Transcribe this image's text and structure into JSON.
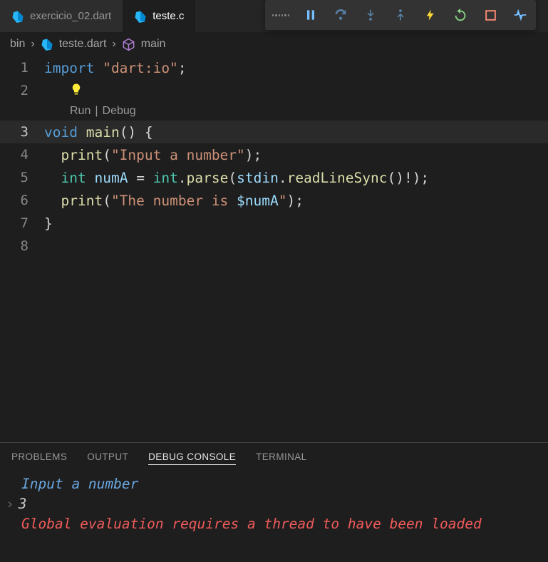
{
  "tabs": {
    "items": [
      {
        "label": "exercicio_02.dart",
        "active": false
      },
      {
        "label": "teste.dart",
        "visible_label": "teste.c",
        "active": true
      }
    ]
  },
  "debug_toolbar": {
    "icons": [
      "grip",
      "pause",
      "step-over",
      "step-into",
      "step-out",
      "hot-reload",
      "restart",
      "stop",
      "dev-tools"
    ]
  },
  "breadcrumbs": {
    "parts": [
      {
        "label": "bin"
      },
      {
        "label": "teste.dart",
        "icon": "dart-icon"
      },
      {
        "label": "main",
        "icon": "cube-icon"
      }
    ]
  },
  "codelens": {
    "run": "Run",
    "debug": "Debug"
  },
  "code": {
    "lines": [
      {
        "n": "1",
        "tokens": [
          "import",
          " ",
          "\"dart:io\"",
          ";"
        ]
      },
      {
        "n": "2",
        "bulb": true
      },
      {
        "n": "3",
        "current": true,
        "tokens_html": "void main() {"
      },
      {
        "n": "4",
        "tokens_html": "  print(\"Input a number\");"
      },
      {
        "n": "5",
        "tokens_html": "  int numA = int.parse(stdin.readLineSync()!);"
      },
      {
        "n": "6",
        "tokens_html": "  print(\"The number is $numA\");"
      },
      {
        "n": "7",
        "tokens_html": "}"
      },
      {
        "n": "8",
        "tokens_html": ""
      }
    ]
  },
  "panel": {
    "tabs": [
      {
        "label": "PROBLEMS"
      },
      {
        "label": "OUTPUT"
      },
      {
        "label": "DEBUG CONSOLE",
        "active": true
      },
      {
        "label": "TERMINAL"
      }
    ],
    "output": {
      "line1": "Input a number",
      "line2": "3",
      "line3": "Global evaluation requires a thread to have been loaded"
    }
  }
}
